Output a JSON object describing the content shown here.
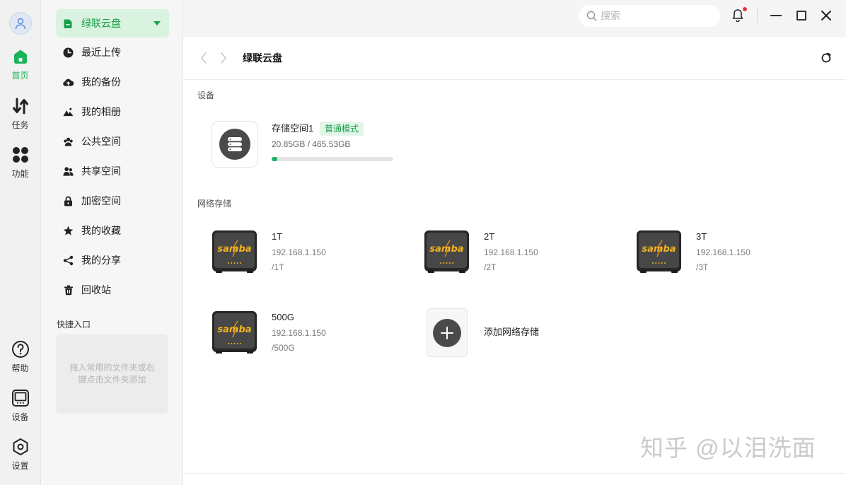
{
  "rail": {
    "avatar_icon": "user-icon",
    "top_items": [
      {
        "label": "首页",
        "icon": "home-icon",
        "active": true
      },
      {
        "label": "任务",
        "icon": "transfer-icon",
        "active": false
      },
      {
        "label": "功能",
        "icon": "apps-icon",
        "active": false
      }
    ],
    "bottom_items": [
      {
        "label": "帮助",
        "icon": "help-icon"
      },
      {
        "label": "设备",
        "icon": "device-icon"
      },
      {
        "label": "设置",
        "icon": "settings-icon"
      }
    ]
  },
  "sidebar": {
    "header": {
      "label": "绿联云盘",
      "icon": "cloud-drive-icon",
      "dropdown_icon": "caret-down-icon"
    },
    "items": [
      {
        "label": "最近上传",
        "icon": "clock-icon"
      },
      {
        "label": "我的备份",
        "icon": "cloud-upload-icon"
      },
      {
        "label": "我的相册",
        "icon": "mountain-icon"
      },
      {
        "label": "公共空间",
        "icon": "group-icon"
      },
      {
        "label": "共享空间",
        "icon": "people-icon"
      },
      {
        "label": "加密空间",
        "icon": "lock-icon"
      },
      {
        "label": "我的收藏",
        "icon": "star-icon"
      },
      {
        "label": "我的分享",
        "icon": "share-icon"
      },
      {
        "label": "回收站",
        "icon": "trash-icon"
      }
    ],
    "quick_access": {
      "title": "快捷入口",
      "hint_lines": [
        "拖入常用的文件夹或右",
        "键点击文件夹添加"
      ]
    }
  },
  "topbar": {
    "search_placeholder": "搜索",
    "search_icon": "search-icon",
    "notification_icon": "bell-icon",
    "has_unread": true,
    "window_controls": [
      "minimize-icon",
      "maximize-icon",
      "close-icon"
    ]
  },
  "header": {
    "title": "绿联云盘",
    "back_icon": "chevron-left-icon",
    "forward_icon": "chevron-right-icon",
    "refresh_icon": "refresh-icon"
  },
  "devices_section": {
    "title": "设备",
    "items": [
      {
        "name": "存储空间1",
        "badge": "普通模式",
        "usage": "20.85GB / 465.53GB",
        "used_fraction": 0.0448,
        "icon": "storage-server-icon"
      }
    ]
  },
  "network_section": {
    "title": "网络存储",
    "logo_text": "samba",
    "items": [
      {
        "name": "1T",
        "host": "192.168.1.150",
        "path": "/1T"
      },
      {
        "name": "2T",
        "host": "192.168.1.150",
        "path": "/2T"
      },
      {
        "name": "3T",
        "host": "192.168.1.150",
        "path": "/3T"
      },
      {
        "name": "500G",
        "host": "192.168.1.150",
        "path": "/500G"
      }
    ],
    "add_label": "添加网络存储",
    "add_icon": "plus-icon"
  },
  "colors": {
    "accent": "#1bb35a",
    "accent_text": "#1a9e4a",
    "accent_bg": "#d9f3e0",
    "notification_dot": "#e53935"
  },
  "watermark": "知乎 @以泪洗面"
}
